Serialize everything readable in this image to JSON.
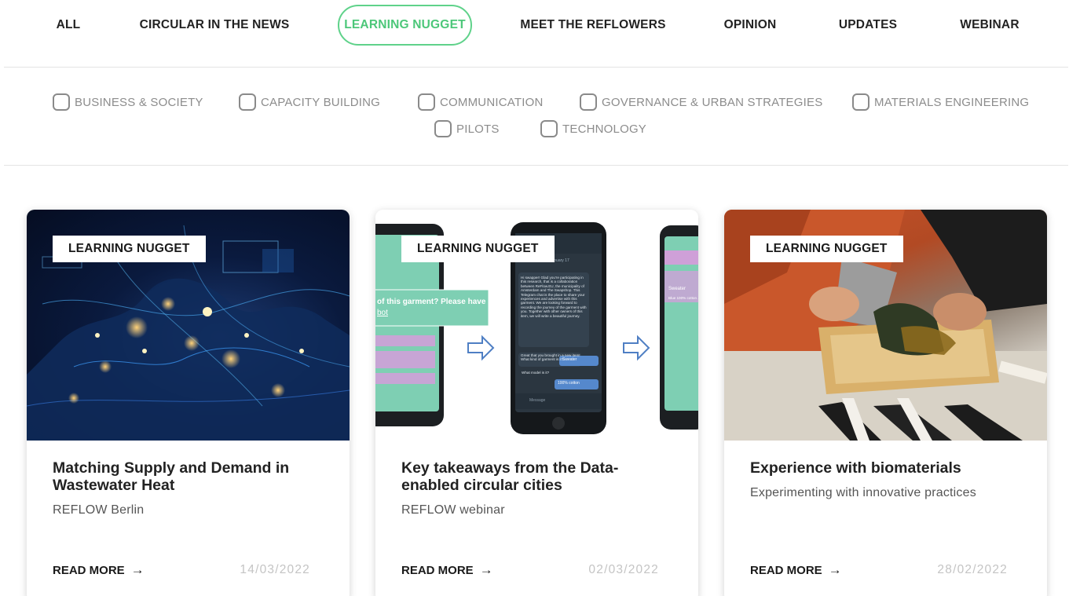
{
  "tabs": [
    {
      "label": "ALL"
    },
    {
      "label": "CIRCULAR IN THE NEWS"
    },
    {
      "label": "LEARNING NUGGET"
    },
    {
      "label": "MEET THE REFLOWERS"
    },
    {
      "label": "OPINION"
    },
    {
      "label": "UPDATES"
    },
    {
      "label": "WEBINAR"
    }
  ],
  "active_tab": "LEARNING NUGGET",
  "accent_color": "#5fd28a",
  "filters": [
    {
      "label": "BUSINESS & SOCIETY",
      "checked": false
    },
    {
      "label": "CAPACITY BUILDING",
      "checked": false
    },
    {
      "label": "COMMUNICATION",
      "checked": false
    },
    {
      "label": "GOVERNANCE & URBAN STRATEGIES",
      "checked": false
    },
    {
      "label": "MATERIALS ENGINEERING",
      "checked": false
    },
    {
      "label": "PILOTS",
      "checked": false
    },
    {
      "label": "TECHNOLOGY",
      "checked": false
    }
  ],
  "cards": [
    {
      "badge": "LEARNING NUGGET",
      "title": "Matching Supply and Demand in Wastewater Heat",
      "subtitle": "REFLOW Berlin",
      "read_more": "READ MORE",
      "date": "14/03/2022"
    },
    {
      "badge": "LEARNING NUGGET",
      "title": "Key takeaways from the Data-enabled circular cities",
      "subtitle": "REFLOW webinar",
      "read_more": "READ MORE",
      "date": "02/03/2022"
    },
    {
      "badge": "LEARNING NUGGET",
      "title": "Experience with biomaterials",
      "subtitle": "Experimenting with innovative practices",
      "read_more": "READ MORE",
      "date": "28/02/2022"
    }
  ],
  "phone_image": {
    "left_question": "of this garment? Please have a",
    "left_link": "bot",
    "chat_header": "swapbot",
    "chat_date": "January 17",
    "chat_text": "Hi swapper! Glad you're participating in this research, that is a collaboration between ReFlow.EU, the municipality of Amsterdam and The Swapshop. This Telegram chat is the place to share your experiences and advertise with this garment. We are looking forward to recording the journey of the garment with you. Together with other owners of this item, we will write a beautiful journey.",
    "chat_text_2": "Great that you brought in a new item! What kind of garment is it?",
    "chat_reply_1": "Sweater",
    "chat_text_3": "What model is it?",
    "chat_reply_2": "100% cotton",
    "chat_input": "Message",
    "right_label": "Sweater",
    "right_text": "Blue 100% cotton ..."
  }
}
